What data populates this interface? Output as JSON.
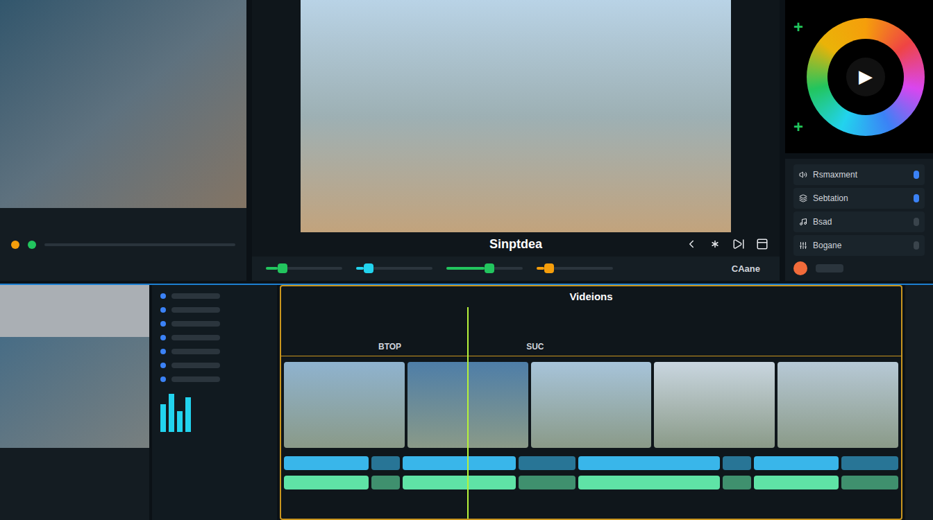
{
  "viewer": {
    "title": "Sinptdea",
    "action": "CAane",
    "sliders": [
      {
        "level": 0.15,
        "color": "#22c55e"
      },
      {
        "level": 0.1,
        "color": "#22d3ee"
      },
      {
        "level": 0.5,
        "color": "#22c55e"
      },
      {
        "level": 0.1,
        "color": "#f59e0b"
      }
    ]
  },
  "color_wheel": {
    "play": "▶",
    "marks": [
      "+",
      "+"
    ]
  },
  "inspector": {
    "items": [
      {
        "label": "Rsmaxment",
        "on": true
      },
      {
        "label": "Sebtation",
        "on": true
      },
      {
        "label": "Bsad",
        "on": false
      },
      {
        "label": "Bogane",
        "on": false
      }
    ],
    "record_color": "#f26b3a"
  },
  "timeline": {
    "title": "Videions",
    "ruler_labels": [
      "BTOP",
      "SUC"
    ],
    "playhead": {
      "level": 0.3
    },
    "clips": [
      {
        "color": "#8fb3cf"
      },
      {
        "color": "#4e7ea8"
      },
      {
        "color": "#a7c4da"
      },
      {
        "color": "#c9d6e0"
      },
      {
        "color": "#b7c9d6"
      }
    ],
    "tracks": [
      {
        "color": "#39b6ea"
      },
      {
        "color": "#5fe3a6"
      }
    ]
  }
}
